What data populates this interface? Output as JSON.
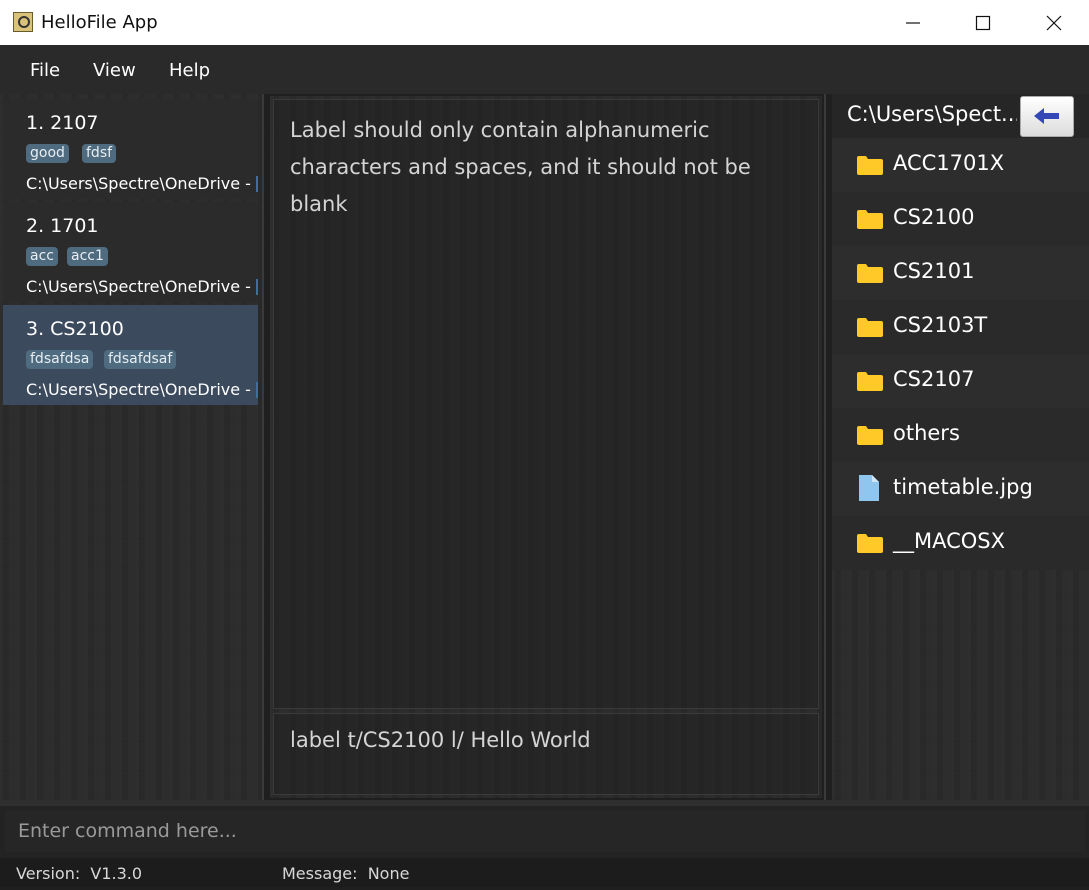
{
  "window": {
    "title": "HelloFile App",
    "minimize": "—",
    "maximize": "☐",
    "close": "✕"
  },
  "menu": [
    {
      "label": "File"
    },
    {
      "label": "View"
    },
    {
      "label": "Help"
    }
  ],
  "tags_list": [
    {
      "title": "1.  2107",
      "tags": [
        "good",
        "fdsf"
      ],
      "path": "C:\\Users\\Spectre\\OneDrive - ",
      "selected": false
    },
    {
      "title": "2.  1701",
      "tags": [
        "acc",
        "acc1"
      ],
      "path": "C:\\Users\\Spectre\\OneDrive - ",
      "selected": false
    },
    {
      "title": "3.  CS2100",
      "tags": [
        "fdsafdsa",
        "fdsafdsaf"
      ],
      "path": "C:\\Users\\Spectre\\OneDrive - ",
      "selected": true
    }
  ],
  "result_display": {
    "text": "Label should only contain alphanumeric characters and spaces, and it should not be blank"
  },
  "history": {
    "text": "label t/CS2100 l/ Hello World"
  },
  "file_explorer": {
    "current_path": "C:\\Users\\Spect...",
    "back_icon": "left-arrow-icon",
    "items": [
      {
        "name": "ACC1701X",
        "type": "folder"
      },
      {
        "name": "CS2100",
        "type": "folder"
      },
      {
        "name": "CS2101",
        "type": "folder"
      },
      {
        "name": "CS2103T",
        "type": "folder"
      },
      {
        "name": "CS2107",
        "type": "folder"
      },
      {
        "name": "others",
        "type": "folder"
      },
      {
        "name": "timetable.jpg",
        "type": "file"
      },
      {
        "name": "__MACOSX",
        "type": "folder"
      }
    ]
  },
  "command_box": {
    "placeholder": "Enter command here..."
  },
  "status": {
    "version": "Version:  V1.3.0",
    "message": "Message:  None"
  },
  "colors": {
    "folder": "#ffc928",
    "file": "#8fc6ef",
    "selected_card": "#3c4a5e",
    "tag": "#4e6b80",
    "back_arrow": "#3348b5"
  }
}
